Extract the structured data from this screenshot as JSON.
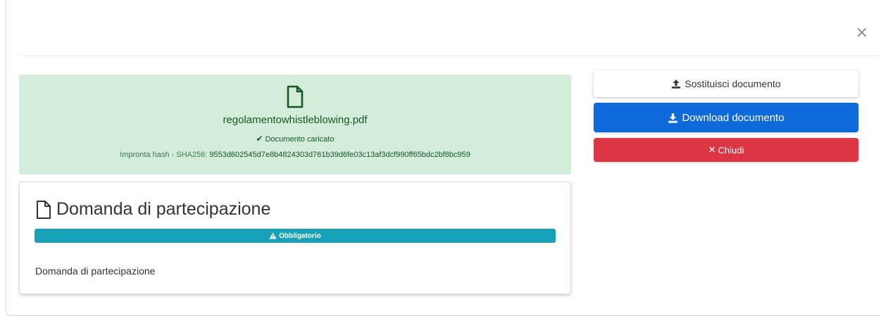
{
  "modal": {
    "close_symbol": "×"
  },
  "file": {
    "icon": "file-icon",
    "name": "regolamentowhistleblowing.pdf",
    "status": "Documento caricato",
    "hash_label": "Impronta hash - SHA256: ",
    "hash_value": "9553d602545d7e8b4824303d761b39d6fe03c13af3dcf990ff65bdc2bf8bc959"
  },
  "card": {
    "title": "Domanda di partecipazione",
    "badge": "Obbligatorio",
    "description": "Domanda di partecipazione"
  },
  "actions": {
    "replace_label": "Sostituisci documento",
    "download_label": "Download documento",
    "close_label": "Chiudi"
  },
  "colors": {
    "success_bg": "#d4edda",
    "success_text": "#155724",
    "info": "#17a2b8",
    "primary": "#0d6ad8",
    "danger": "#dc3545"
  }
}
